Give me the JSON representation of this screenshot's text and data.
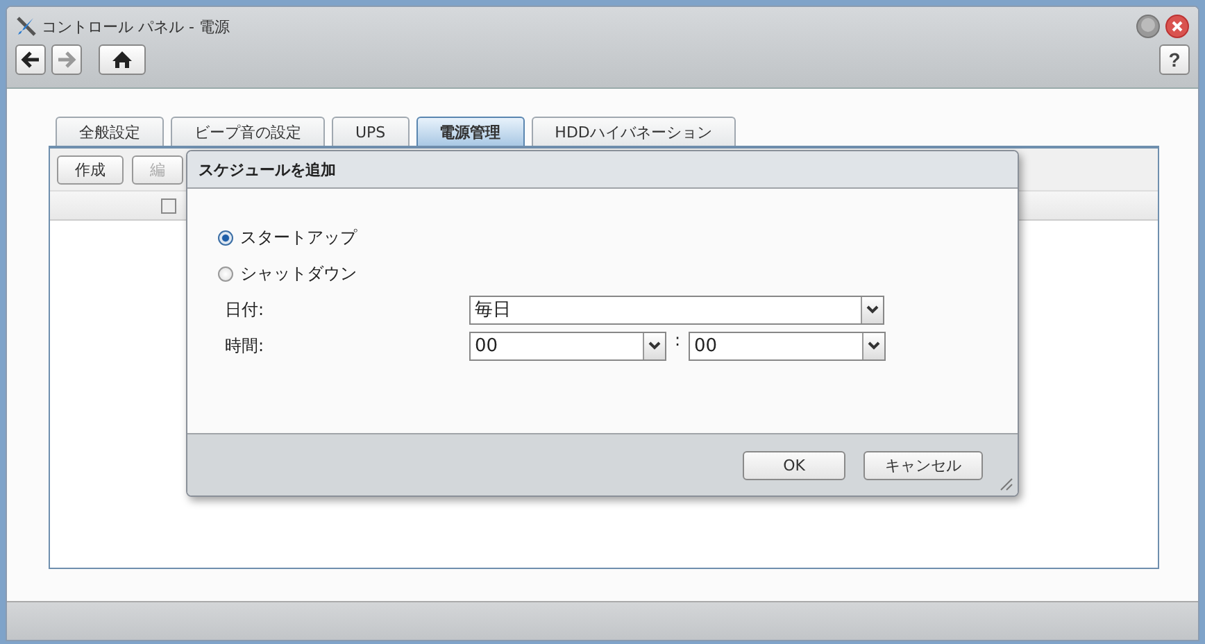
{
  "window": {
    "title": "コントロール パネル - 電源"
  },
  "toolbar": {
    "help": "?"
  },
  "tabs": [
    {
      "label": "全般設定",
      "selected": false
    },
    {
      "label": "ビープ音の設定",
      "selected": false
    },
    {
      "label": "UPS",
      "selected": false
    },
    {
      "label": "電源管理",
      "selected": true
    },
    {
      "label": "HDDハイバネーション",
      "selected": false
    }
  ],
  "panel": {
    "buttons": [
      {
        "label": "作成",
        "disabled": false
      },
      {
        "label": "編",
        "disabled": true
      }
    ],
    "header_checkbox": {
      "checked": false
    }
  },
  "dialog": {
    "title": "スケジュールを追加",
    "options": [
      {
        "label": "スタートアップ",
        "selected": true
      },
      {
        "label": "シャットダウン",
        "selected": false
      }
    ],
    "date": {
      "label": "日付:",
      "value": "毎日"
    },
    "time": {
      "label": "時間:",
      "hour": "00",
      "separator": ":",
      "minute": "00"
    },
    "buttons": [
      "OK",
      "キャンセル"
    ]
  }
}
